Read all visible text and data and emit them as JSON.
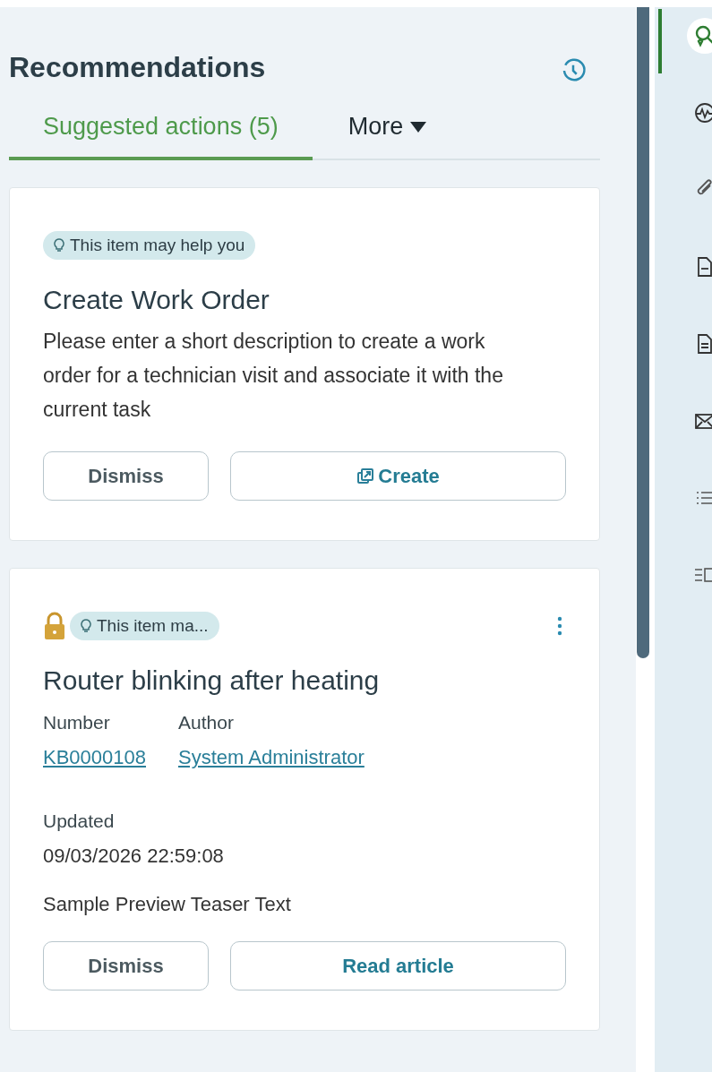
{
  "header": {
    "title": "Recommendations"
  },
  "tabs": [
    {
      "label": "Suggested actions (5)",
      "selected": true,
      "kind": "tab"
    },
    {
      "label": "More",
      "selected": false,
      "kind": "dropdown"
    }
  ],
  "cards": [
    {
      "kind": "action",
      "locked": false,
      "has_menu": false,
      "badge": "This item may help you",
      "title": "Create Work Order",
      "description": "Please enter a short description to create a work order for a technician visit and associate it with the current task",
      "buttons": [
        {
          "label": "Dismiss",
          "kind": "secondary"
        },
        {
          "label": "Create",
          "kind": "create"
        }
      ]
    },
    {
      "kind": "article",
      "locked": true,
      "has_menu": true,
      "badge": "This item ma...",
      "title": "Router blinking after heating",
      "fields": [
        {
          "label": "Number",
          "value": "KB0000108"
        },
        {
          "label": "Author",
          "value": "System Administrator"
        }
      ],
      "updated_label": "Updated",
      "updated_value": "09/03/2026 22:59:08",
      "teaser": "Sample Preview Teaser Text",
      "buttons": [
        {
          "label": "Dismiss",
          "kind": "secondary"
        },
        {
          "label": "Read article",
          "kind": "primary"
        }
      ]
    }
  ],
  "rail": {
    "items": [
      {
        "kind": "recommendations",
        "selected": true
      },
      {
        "kind": "activity",
        "selected": false
      },
      {
        "kind": "attachment",
        "selected": false
      },
      {
        "kind": "document",
        "selected": false
      },
      {
        "kind": "article",
        "selected": false
      },
      {
        "kind": "email",
        "selected": false
      },
      {
        "kind": "list",
        "selected": false
      },
      {
        "kind": "panel",
        "selected": false
      }
    ]
  }
}
